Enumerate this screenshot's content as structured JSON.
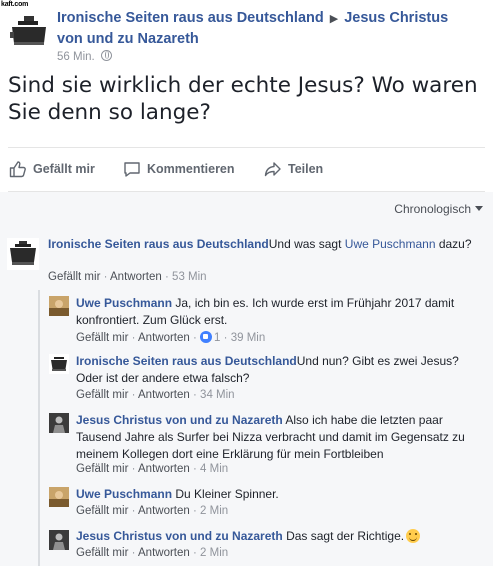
{
  "watermark": "kaft.com",
  "post": {
    "author": "Ironische Seiten raus aus Deutschland",
    "target": "Jesus Christus von und zu Nazareth",
    "time": "56 Min.",
    "text": "Sind sie wirklich der echte Jesus? Wo waren Sie denn so lange?"
  },
  "actions": {
    "like": "Gefällt mir",
    "comment": "Kommentieren",
    "share": "Teilen"
  },
  "sort_label": "Chronologisch",
  "comments": [
    {
      "author": "Ironische Seiten raus aus Deutschland",
      "text_pre": "Und was sagt ",
      "mention": "Uwe Puschmann",
      "text_post": " dazu?",
      "like": "Gefällt mir",
      "reply": "Antworten",
      "time": "53 Min"
    }
  ],
  "replies": [
    {
      "author": "Uwe Puschmann",
      "text": "Ja, ich bin es. Ich wurde erst im Frühjahr 2017 damit konfrontiert. Zum Glück erst.",
      "like": "Gefällt mir",
      "reply": "Antworten",
      "reactions": "1",
      "time": "39 Min"
    },
    {
      "author": "Ironische Seiten raus aus Deutschland",
      "text": "Und nun? Gibt es zwei Jesus? Oder ist der andere etwa falsch?",
      "like": "Gefällt mir",
      "reply": "Antworten",
      "time": "34 Min"
    },
    {
      "author": "Jesus Christus von und zu Nazareth",
      "text": "Also ich habe die letzten paar Tausend Jahre als Surfer bei Nizza verbracht und damit im Gegensatz zu meinem Kollegen dort eine Erklärung für mein Fortbleiben",
      "like": "Gefällt mir",
      "reply": "Antworten",
      "time": "4 Min"
    },
    {
      "author": "Uwe Puschmann",
      "text": "Du Kleiner Spinner.",
      "like": "Gefällt mir",
      "reply": "Antworten",
      "time": "2 Min"
    },
    {
      "author": "Jesus Christus von und zu Nazareth",
      "text": "Das sagt der Richtige.",
      "like": "Gefällt mir",
      "reply": "Antworten",
      "time": "2 Min"
    }
  ],
  "separator": "·",
  "colors": {
    "link": "#365899",
    "meta": "#90949c",
    "text": "#1d2129",
    "feedback_bg": "#f6f7f9",
    "like_blue": "#4080ff"
  },
  "icons": [
    "kettle-avatar-icon",
    "globe-icon",
    "like-icon",
    "comment-icon",
    "share-icon",
    "caret-down-icon",
    "like-reaction-icon",
    "smiley-emoji-icon"
  ]
}
